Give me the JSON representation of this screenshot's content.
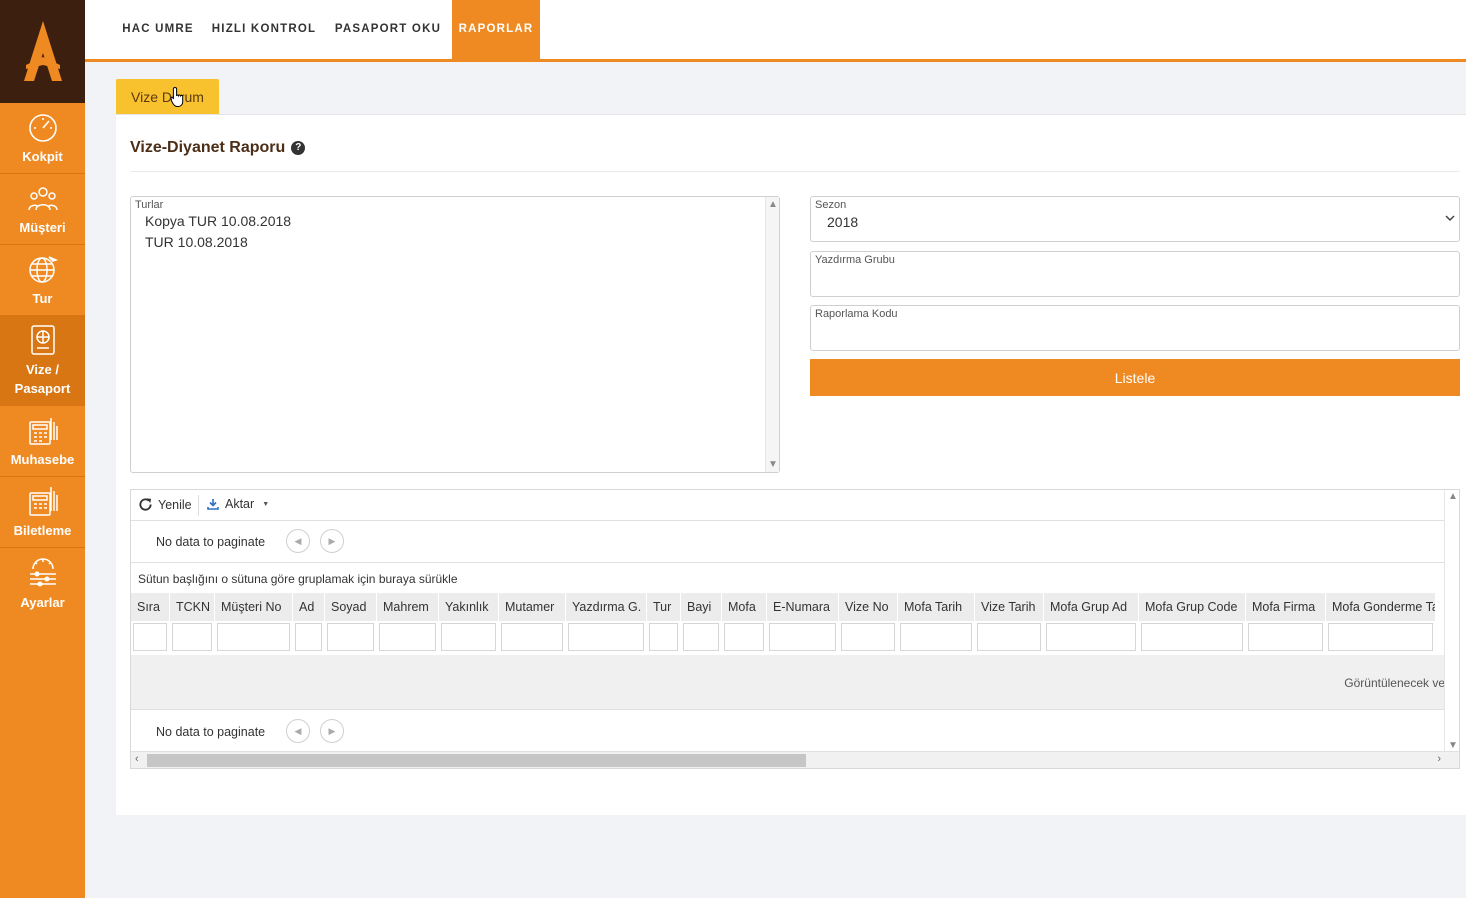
{
  "sidebar": {
    "items": [
      {
        "label": "Kokpit",
        "icon": "speedometer-icon"
      },
      {
        "label": "Müşteri",
        "icon": "customers-icon"
      },
      {
        "label": "Tur",
        "icon": "globe-plane-icon"
      },
      {
        "label": "Vize / Pasaport",
        "icon": "passport-icon"
      },
      {
        "label": "Muhasebe",
        "icon": "calculator-icon"
      },
      {
        "label": "Biletleme",
        "icon": "ticketing-icon"
      },
      {
        "label": "Ayarlar",
        "icon": "settings-sliders-icon"
      }
    ]
  },
  "topnav": {
    "tabs": [
      "HAC UMRE",
      "HIZLI KONTROL",
      "PASAPORT OKU",
      "RAPORLAR"
    ],
    "active": "RAPORLAR"
  },
  "subtab": {
    "label": "Vize Durum"
  },
  "page": {
    "title": "Vize-Diyanet Raporu"
  },
  "turlar": {
    "label": "Turlar",
    "options": [
      "Kopya TUR 10.08.2018",
      "TUR 10.08.2018"
    ]
  },
  "form": {
    "sezon": {
      "label": "Sezon",
      "value": "2018"
    },
    "yazdirma_grubu": {
      "label": "Yazdırma Grubu",
      "value": ""
    },
    "raporlama_kodu": {
      "label": "Raporlama Kodu",
      "value": ""
    },
    "listele_label": "Listele"
  },
  "grid": {
    "toolbar": {
      "refresh_label": "Yenile",
      "export_label": "Aktar"
    },
    "pager_text": "No data to paginate",
    "group_hint": "Sütun başlığını o sütuna göre gruplamak için buraya sürükle",
    "columns": [
      "Sıra",
      "TCKN",
      "Müşteri No",
      "Ad",
      "Soyad",
      "Mahrem",
      "Yakınlık",
      "Mutamer",
      "Yazdırma G.",
      "Tur",
      "Bayi",
      "Mofa",
      "E-Numara",
      "Vize No",
      "Mofa Tarih",
      "Vize Tarih",
      "Mofa Grup Ad",
      "Mofa Grup Code",
      "Mofa Firma",
      "Mofa Gonderme Ta"
    ],
    "empty_text": "Görüntülenecek ve"
  },
  "colors": {
    "accent": "#ef8a22",
    "dark_brown": "#3d1f0f",
    "subtab": "#f8c12e"
  }
}
